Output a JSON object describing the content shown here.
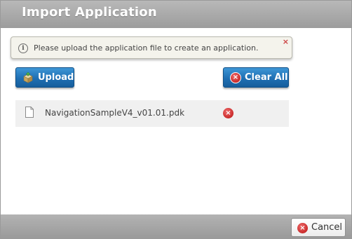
{
  "dialog": {
    "title": "Import Application"
  },
  "notice": {
    "icon": "info-icon",
    "icon_glyph": "i",
    "text": "Please upload the application file to create an application.",
    "close_glyph": "×"
  },
  "toolbar": {
    "upload_label": "Upload",
    "upload_icon": "package-upload-icon",
    "clear_all_label": "Clear All",
    "clear_all_icon": "clear-icon",
    "clear_glyph": "×"
  },
  "files": [
    {
      "name": "NavigationSampleV4_v01.01.pdk",
      "icon": "file-icon",
      "remove_icon": "remove-icon",
      "remove_glyph": "×"
    }
  ],
  "footer": {
    "cancel_label": "Cancel",
    "cancel_icon": "cancel-icon",
    "cancel_glyph": "×"
  },
  "colors": {
    "title_bar": "#a9a9a9",
    "primary_button": "#1f6fb3",
    "danger_icon": "#c92a2a",
    "notice_bg": "#f4f3ec",
    "file_row_bg": "#f0f0f0"
  }
}
